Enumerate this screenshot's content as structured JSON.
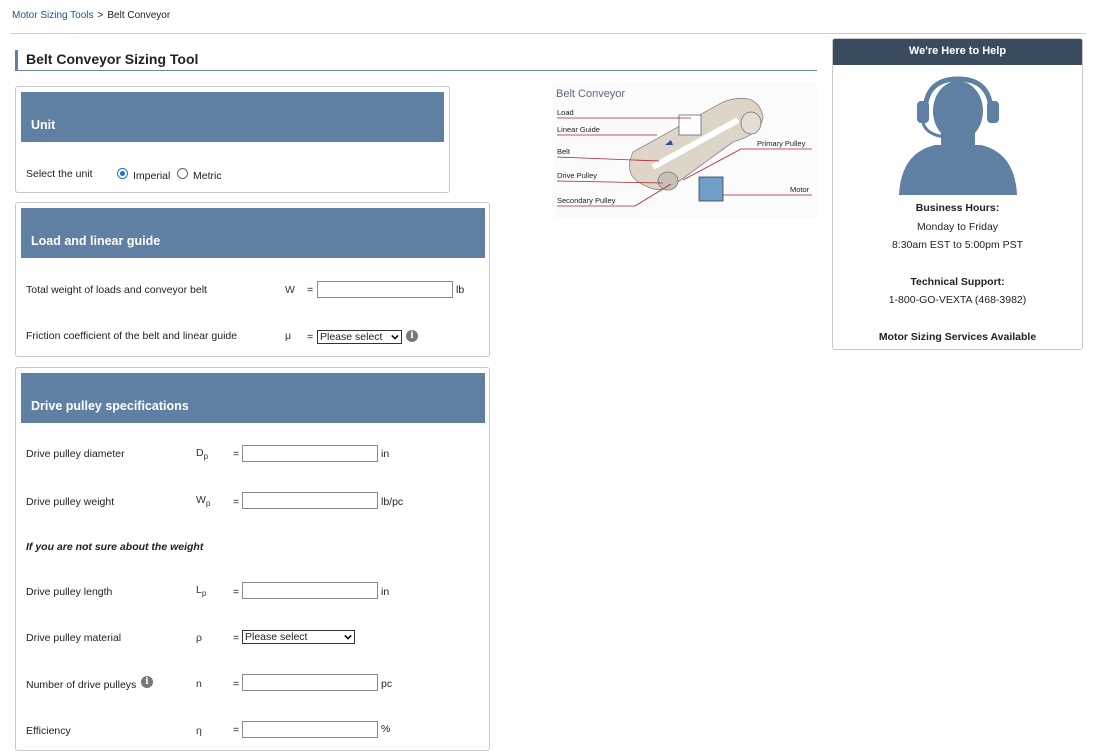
{
  "breadcrumb": {
    "link": "Motor Sizing Tools",
    "separator": ">",
    "current": "Belt Conveyor"
  },
  "page_title": "Belt Conveyor Sizing Tool",
  "unit_panel": {
    "heading": "Unit",
    "select_label": "Select the unit",
    "options": [
      "Imperial",
      "Metric"
    ],
    "selected": "Imperial"
  },
  "load_panel": {
    "heading": "Load and linear guide",
    "weight": {
      "label": "Total weight of loads and conveyor belt",
      "symbol": "W",
      "eq": "=",
      "value": "",
      "unit": "lb"
    },
    "friction": {
      "label": "Friction coefficient of the belt and linear guide",
      "symbol": "μ",
      "eq": "=",
      "selected": "Please select"
    }
  },
  "drive_panel": {
    "heading": "Drive pulley specifications",
    "diameter": {
      "label": "Drive pulley diameter",
      "symbol": "D",
      "sub": "p",
      "eq": "=",
      "value": "",
      "unit": "in"
    },
    "weight": {
      "label": "Drive pulley weight",
      "symbol": "W",
      "sub": "p",
      "eq": "=",
      "value": "",
      "unit": "lb/pc"
    },
    "note": "If you are not sure about the weight",
    "length": {
      "label": "Drive pulley length",
      "symbol": "L",
      "sub": "p",
      "eq": "=",
      "value": "",
      "unit": "in"
    },
    "material": {
      "label": "Drive pulley material",
      "symbol": "ρ",
      "eq": "=",
      "selected": "Please select"
    },
    "count": {
      "label": "Number of drive pulleys",
      "symbol": "n",
      "eq": "=",
      "value": "",
      "unit": "pc"
    },
    "efficiency": {
      "label": "Efficiency",
      "symbol": "η",
      "eq": "=",
      "value": "",
      "unit": "%"
    }
  },
  "diagram": {
    "title": "Belt Conveyor",
    "labels": [
      "Load",
      "Linear Guide",
      "Belt",
      "Drive Pulley",
      "Secondary Pulley",
      "Primary Pulley",
      "Motor"
    ],
    "colors": {
      "belt": "#ddd5c8",
      "arrow": "#b02030",
      "motor": "#6f9fc8"
    }
  },
  "help": {
    "heading": "We're Here to Help",
    "hours_title": "Business Hours:",
    "hours_days": "Monday to Friday",
    "hours_time": "8:30am EST to 5:00pm PST",
    "support_title": "Technical Support:",
    "support_phone": "1-800-GO-VEXTA (468-3982)",
    "services": "Motor Sizing Services Available"
  },
  "colors": {
    "panel_header": "#5f7fa3",
    "help_header": "#3b4b5f",
    "link": "#1f4f8f",
    "avatar": "#5f7fa3"
  }
}
